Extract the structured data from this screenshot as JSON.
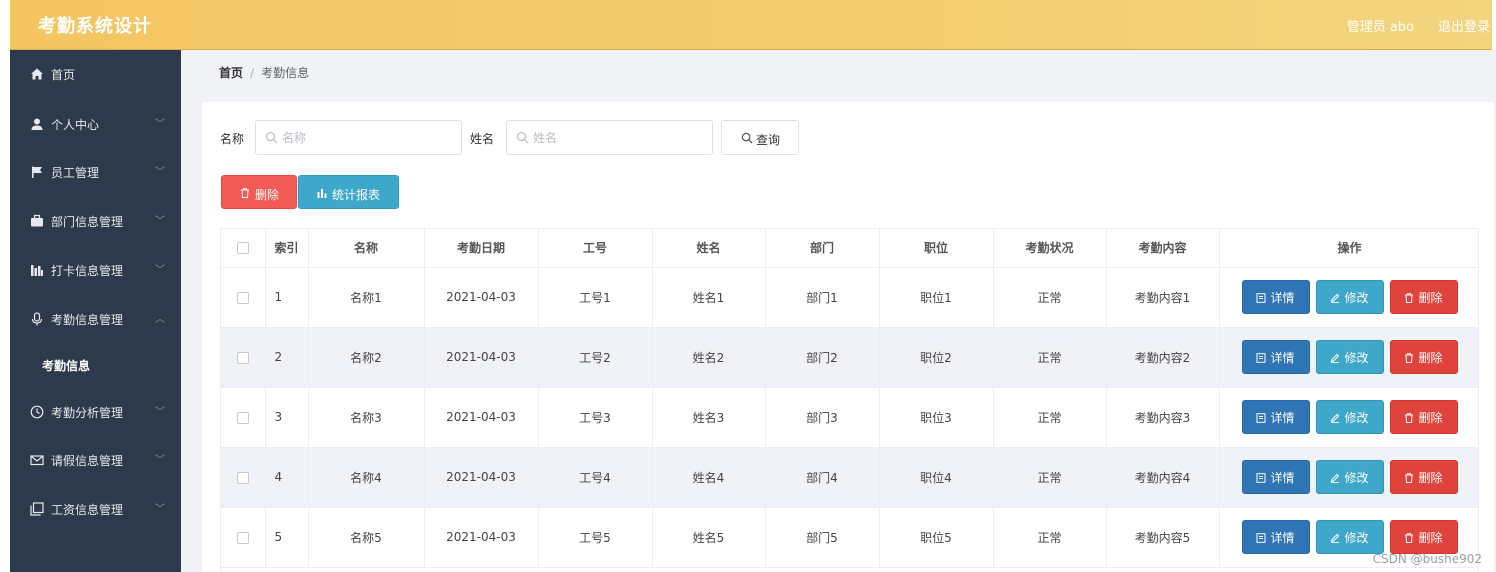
{
  "app": {
    "title": "考勤系统设计",
    "user_label": "管理员 abo",
    "logout_label": "退出登录"
  },
  "sidebar": {
    "items": [
      {
        "label": "首页",
        "icon": "home-icon"
      },
      {
        "label": "个人中心",
        "icon": "user-icon"
      },
      {
        "label": "员工管理",
        "icon": "flag-icon"
      },
      {
        "label": "部门信息管理",
        "icon": "briefcase-icon"
      },
      {
        "label": "打卡信息管理",
        "icon": "bar-chart-icon"
      },
      {
        "label": "考勤信息管理",
        "icon": "microphone-icon"
      },
      {
        "label": "考勤分析管理",
        "icon": "clock-icon"
      },
      {
        "label": "请假信息管理",
        "icon": "mail-icon"
      },
      {
        "label": "工资信息管理",
        "icon": "copy-icon"
      }
    ],
    "active_sub": "考勤信息"
  },
  "breadcrumb": {
    "home": "首页",
    "separator": "/",
    "current": "考勤信息"
  },
  "search": {
    "name_label": "名称",
    "name_placeholder": "名称",
    "person_label": "姓名",
    "person_placeholder": "姓名",
    "query_button": "查询"
  },
  "toolbar": {
    "delete_label": "删除",
    "report_label": "统计报表"
  },
  "table": {
    "headers": [
      "索引",
      "名称",
      "考勤日期",
      "工号",
      "姓名",
      "部门",
      "职位",
      "考勤状况",
      "考勤内容",
      "操作"
    ],
    "rows": [
      [
        "1",
        "名称1",
        "2021-04-03",
        "工号1",
        "姓名1",
        "部门1",
        "职位1",
        "正常",
        "考勤内容1"
      ],
      [
        "2",
        "名称2",
        "2021-04-03",
        "工号2",
        "姓名2",
        "部门2",
        "职位2",
        "正常",
        "考勤内容2"
      ],
      [
        "3",
        "名称3",
        "2021-04-03",
        "工号3",
        "姓名3",
        "部门3",
        "职位3",
        "正常",
        "考勤内容3"
      ],
      [
        "4",
        "名称4",
        "2021-04-03",
        "工号4",
        "姓名4",
        "部门4",
        "职位4",
        "正常",
        "考勤内容4"
      ],
      [
        "5",
        "名称5",
        "2021-04-03",
        "工号5",
        "姓名5",
        "部门5",
        "职位5",
        "正常",
        "考勤内容5"
      ]
    ],
    "actions": {
      "detail": "详情",
      "edit": "修改",
      "delete": "删除"
    }
  },
  "watermark": "CSDN @bushe902",
  "colors": {
    "topbar": "#f3c866",
    "sidebar": "#2d3a4b",
    "danger": "#e0423c",
    "info": "#3fa7c9",
    "primary": "#2f75b5"
  }
}
